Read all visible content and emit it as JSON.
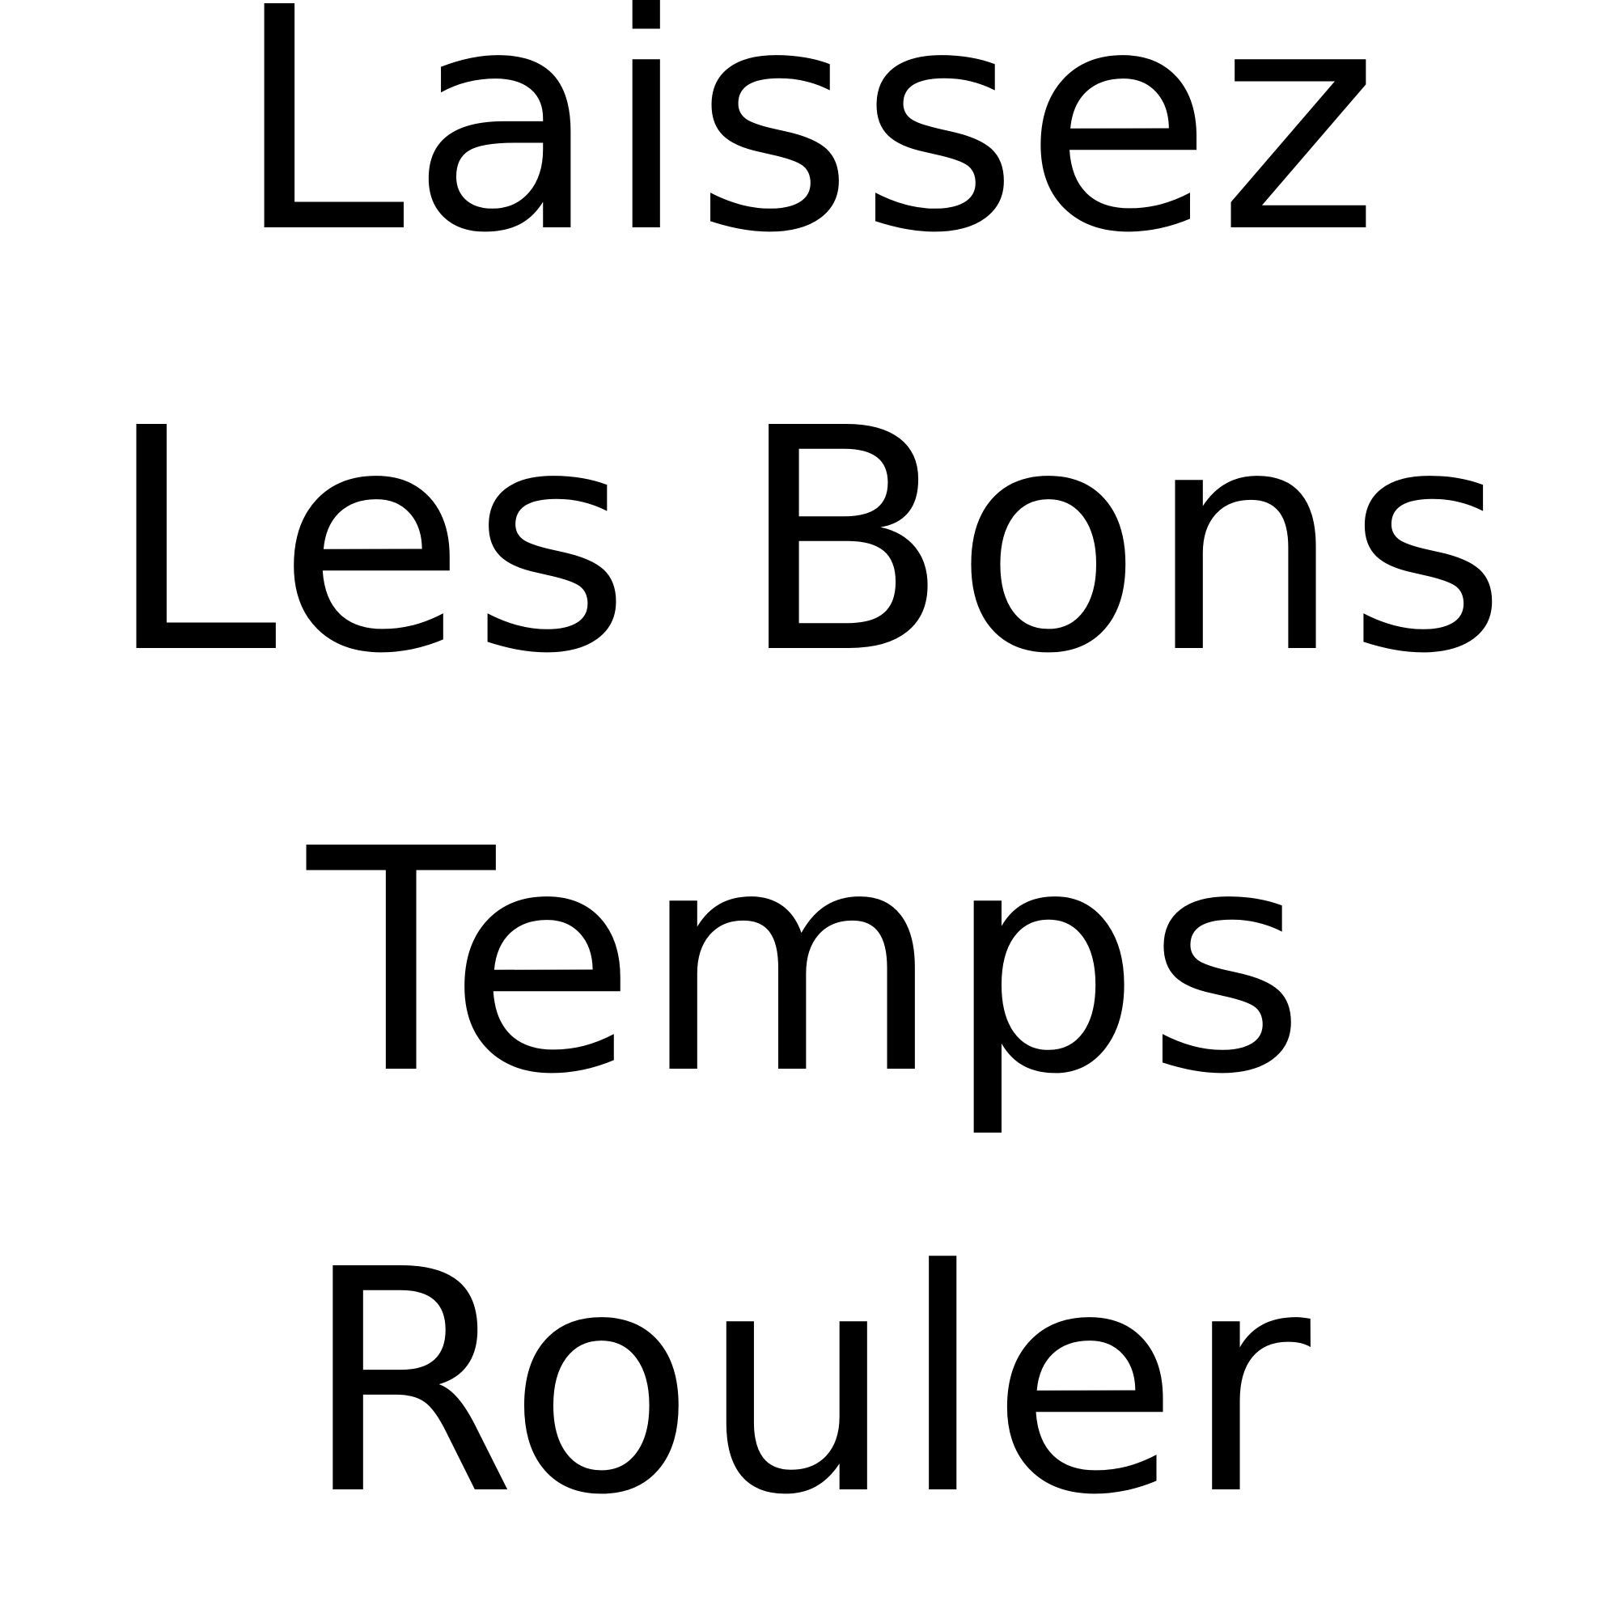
{
  "text_lines": [
    "Laissez",
    "Les Bons",
    "Temps",
    "Rouler"
  ],
  "colors": {
    "background": "#ffffff",
    "text": "#000000"
  }
}
